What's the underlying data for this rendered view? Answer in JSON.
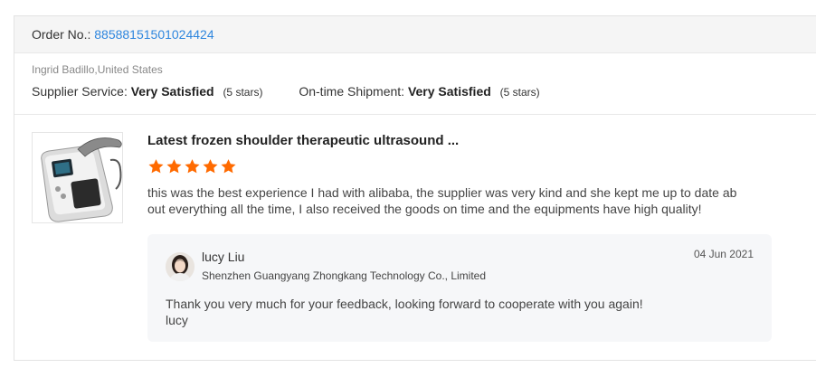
{
  "order": {
    "label": "Order No.:",
    "number": "88588151501024424"
  },
  "buyer": {
    "name_country": "Ingrid Badillo,United States",
    "supplier_service_label": "Supplier Service:",
    "supplier_service_value": "Very Satisfied",
    "supplier_service_stars": "(5 stars)",
    "shipment_label": "On-time Shipment:",
    "shipment_value": "Very Satisfied",
    "shipment_stars": "(5 stars)"
  },
  "product": {
    "title": "Latest frozen shoulder therapeutic ultrasound ...",
    "rating": 5,
    "star_color": "#ff6a00",
    "image_icon": "ultrasound-device-thumbnail"
  },
  "review": {
    "text": "this was the best experience I had with alibaba, the supplier was very kind and she kept me up to date about everything all the time, I also received the goods on time and the equipments have high quality!"
  },
  "reply": {
    "name": "lucy Liu",
    "company": "Shenzhen Guangyang Zhongkang Technology Co., Limited",
    "date": "04 Jun 2021",
    "message_line1": "Thank you very much for your feedback, looking forward to cooperate with you again!",
    "message_line2": "lucy"
  },
  "colors": {
    "link": "#2e86de",
    "header_bg": "#f5f5f5",
    "reply_bg": "#f6f7f9"
  }
}
